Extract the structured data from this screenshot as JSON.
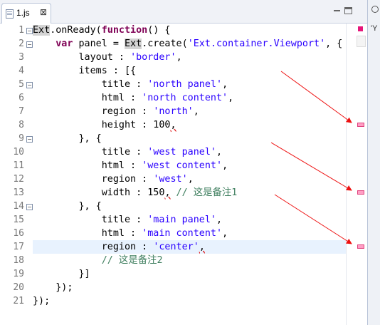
{
  "tab": {
    "title": "1.js",
    "close": "⊠"
  },
  "sidepanel": {
    "label": "'Y"
  },
  "editor": {
    "line_numbers": [
      "1",
      "2",
      "3",
      "4",
      "5",
      "6",
      "7",
      "8",
      "9",
      "10",
      "11",
      "12",
      "13",
      "14",
      "15",
      "16",
      "17",
      "18",
      "19",
      "20",
      "21"
    ],
    "annotated_lines": [
      8,
      13,
      17
    ],
    "current_line": 17
  },
  "colors": {
    "keyword": "#7f0055",
    "string": "#2a00ff",
    "comment": "#3f7f5f",
    "marker": "#ff9ec4",
    "arrow": "#ee1111"
  },
  "code": {
    "l1": {
      "ident": "Ext",
      "a": ".onReady(",
      "kw": "function",
      "b": "() {"
    },
    "l2": {
      "indent": "    ",
      "kw": "var",
      "a": " panel = ",
      "ident": "Ext",
      "b": ".create(",
      "str": "'Ext.container.Viewport'",
      "c": ", {"
    },
    "l3": {
      "a": "        layout : ",
      "str": "'border'",
      "b": ","
    },
    "l4": {
      "a": "        items : [{"
    },
    "l5": {
      "a": "            title : ",
      "str": "'north panel'",
      "b": ","
    },
    "l6": {
      "a": "            html : ",
      "str": "'north content'",
      "b": ","
    },
    "l7": {
      "a": "            region : ",
      "str": "'north'",
      "b": ","
    },
    "l8": {
      "a": "            height : 100",
      "b": ","
    },
    "l9": {
      "a": "        }, {"
    },
    "l10": {
      "a": "            title : ",
      "str": "'west panel'",
      "b": ","
    },
    "l11": {
      "a": "            html : ",
      "str": "'west content'",
      "b": ","
    },
    "l12": {
      "a": "            region : ",
      "str": "'west'",
      "b": ","
    },
    "l13": {
      "a": "            width : 150",
      "b": ",",
      "cmt": " // 这是备注1"
    },
    "l14": {
      "a": "        }, {"
    },
    "l15": {
      "a": "            title : ",
      "str": "'main panel'",
      "b": ","
    },
    "l16": {
      "a": "            html : ",
      "str": "'main content'",
      "b": ","
    },
    "l17": {
      "a": "            region : ",
      "str": "'center'",
      "b": ","
    },
    "l18": {
      "cmt": "            // 这是备注2"
    },
    "l19": {
      "a": "        }]"
    },
    "l20": {
      "a": "    });"
    },
    "l21": {
      "a": "});"
    }
  }
}
